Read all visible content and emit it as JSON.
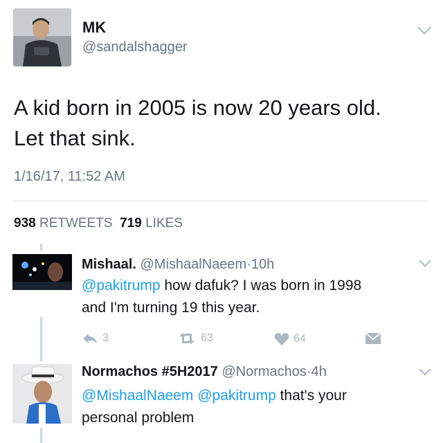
{
  "tweet": {
    "display_name": "MK",
    "handle": "@sandalshagger",
    "text_line1": "A kid born in 2005 is now 20 years old.",
    "text_line2": "Let that sink.",
    "timestamp": "1/16/17, 11:52 AM",
    "retweet_count": "938",
    "retweet_label": "RETWEETS",
    "like_count": "719",
    "like_label": "LIKES"
  },
  "replies": [
    {
      "name": "Mishaal.",
      "handle": "@MishaalNaeem",
      "separator": "·",
      "time": "10h",
      "mention1": "@pakitrump",
      "text_rest1": " how dafuk? I was born in 1998",
      "text_line2": "and I'm turning 19 this year.",
      "reply_count": "3",
      "retweet_count": "63",
      "like_count": "64"
    },
    {
      "name": "Normachos #5H2017",
      "handle": "@Normachos",
      "separator": "·",
      "time": "4h",
      "mention1": "@MishaalNaeem",
      "mention2": "@pakitrump",
      "text_rest1": " that's your",
      "text_line2": "personal problem"
    }
  ],
  "icons": {
    "reply": "reply-icon",
    "retweet": "retweet-icon",
    "like": "heart-icon",
    "dm": "envelope-icon",
    "caret": "chevron-down-icon"
  },
  "colors": {
    "link": "#1da1f2",
    "muted": "#657786",
    "icon": "#aab8c2"
  }
}
